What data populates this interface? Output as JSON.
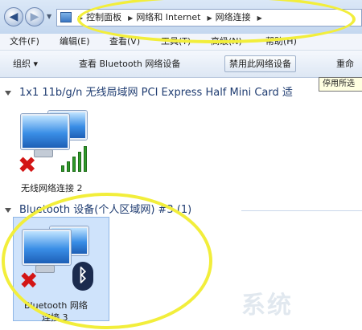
{
  "address": {
    "breadcrumbs": [
      "控制面板",
      "网络和 Internet",
      "网络连接"
    ]
  },
  "menu": {
    "items": [
      "文件(F)",
      "编辑(E)",
      "查看(V)",
      "工具(T)",
      "高级(N)",
      "帮助(H)"
    ]
  },
  "toolbar": {
    "organize": "组织 ▾",
    "view_bluetooth": "查看 Bluetooth 网络设备",
    "disable": "禁用此网络设备",
    "rename": "重命"
  },
  "tooltip": "停用所选",
  "groups": [
    {
      "title": "1x1 11b/g/n 无线局域网 PCI Express Half Mini Card 适",
      "adapter_label": "无线网络连接 2"
    },
    {
      "title": "Bluetooth 设备(个人区域网) #3 (1)",
      "adapter_label_line1": "Bluetooth 网络",
      "adapter_label_line2": "连接 3"
    }
  ],
  "colors": {
    "annotation": "#f2ee3b",
    "error_x": "#d31515",
    "signal": "#2f9b2a",
    "bluetooth": "#1b2b4e"
  },
  "icons": [
    "back-arrow-icon",
    "forward-arrow-icon",
    "control-panel-icon",
    "computer-network-icon",
    "red-x-icon",
    "signal-bars-icon",
    "bluetooth-icon"
  ]
}
